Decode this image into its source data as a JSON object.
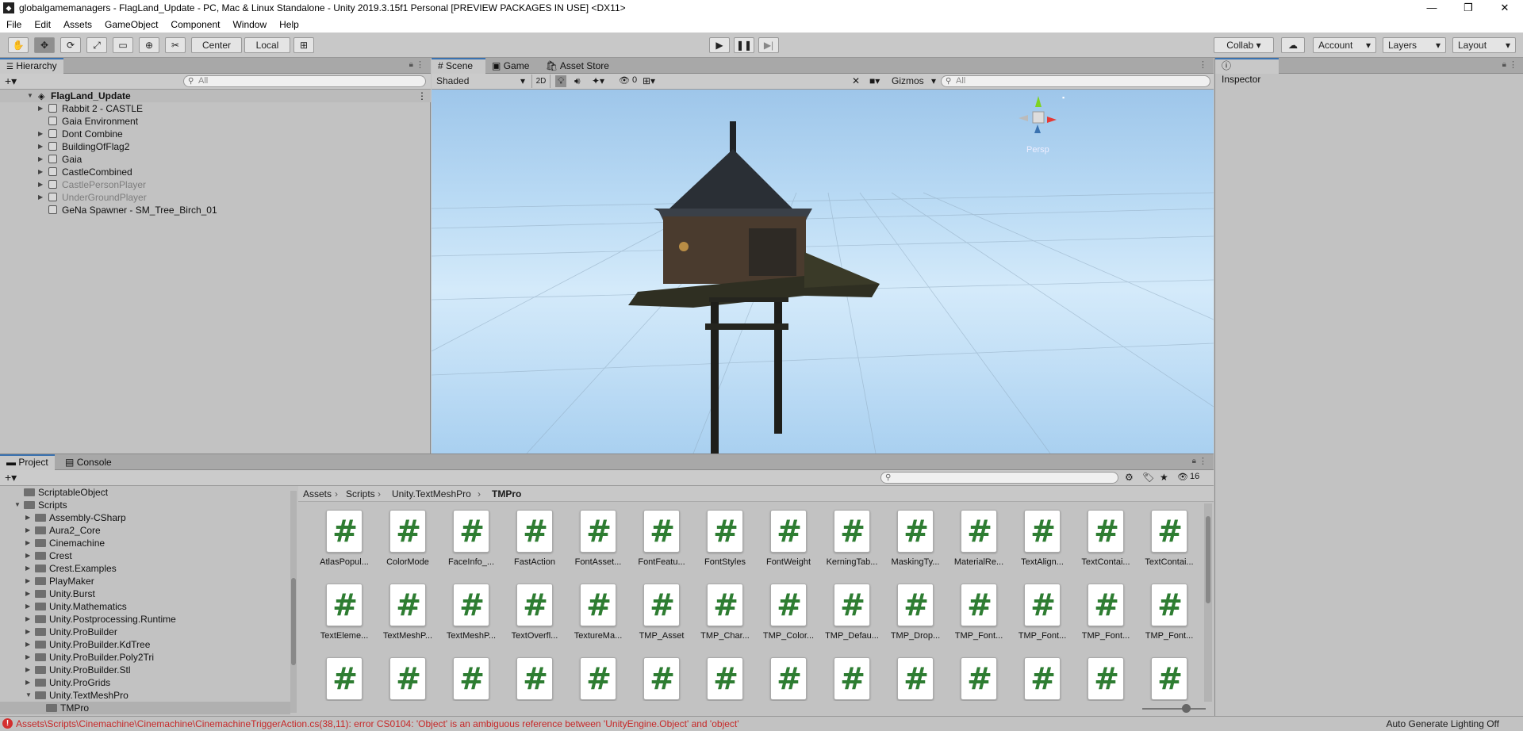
{
  "window": {
    "title": "globalgamemanagers - FlagLand_Update - PC, Mac & Linux Standalone - Unity 2019.3.15f1 Personal [PREVIEW PACKAGES IN USE] <DX11>",
    "controls": {
      "minimize": "—",
      "maximize": "❐",
      "close": "✕"
    }
  },
  "menu": [
    "File",
    "Edit",
    "Assets",
    "GameObject",
    "Component",
    "Window",
    "Help"
  ],
  "toolbar": {
    "tools": [
      "hand-tool-icon",
      "move-tool-icon",
      "rotate-tool-icon",
      "scale-tool-icon",
      "rect-tool-icon",
      "transform-tool-icon",
      "custom-tool-icon"
    ],
    "pivot_label": "Center",
    "space_label": "Local",
    "collab_label": "Collab ▾",
    "account_label": "Account",
    "layers_label": "Layers",
    "layout_label": "Layout"
  },
  "hierarchy": {
    "tab_label": "Hierarchy",
    "search_placeholder": "All",
    "scene_name": "FlagLand_Update",
    "items": [
      {
        "label": "Rabbit 2 - CASTLE",
        "has_children": true,
        "disabled": false
      },
      {
        "label": "Gaia Environment",
        "has_children": false,
        "disabled": false
      },
      {
        "label": "Dont Combine",
        "has_children": true,
        "disabled": false
      },
      {
        "label": "BuildingOfFlag2",
        "has_children": true,
        "disabled": false
      },
      {
        "label": "Gaia",
        "has_children": true,
        "disabled": false
      },
      {
        "label": "CastleCombined",
        "has_children": true,
        "disabled": false
      },
      {
        "label": "CastlePersonPlayer",
        "has_children": true,
        "disabled": true
      },
      {
        "label": "UnderGroundPlayer",
        "has_children": true,
        "disabled": true
      },
      {
        "label": "GeNa Spawner - SM_Tree_Birch_01",
        "has_children": false,
        "disabled": false
      }
    ]
  },
  "scene": {
    "tabs": [
      "Scene",
      "Game",
      "Asset Store"
    ],
    "shading_mode": "Shaded",
    "mode_2d": "2D",
    "hidden_count": "0",
    "gizmos_label": "Gizmos",
    "search_placeholder": "All",
    "persp_label": "Persp"
  },
  "inspector": {
    "tab_label": "Inspector"
  },
  "project": {
    "tabs": [
      "Project",
      "Console"
    ],
    "hidden_count": "16",
    "breadcrumb": [
      "Assets",
      "Scripts",
      "Unity.TextMeshPro",
      "TMPro"
    ],
    "tree": [
      {
        "label": "ScriptableObject",
        "depth": 1,
        "expanded": null
      },
      {
        "label": "Scripts",
        "depth": 1,
        "expanded": true
      },
      {
        "label": "Assembly-CSharp",
        "depth": 2,
        "expanded": false
      },
      {
        "label": "Aura2_Core",
        "depth": 2,
        "expanded": false
      },
      {
        "label": "Cinemachine",
        "depth": 2,
        "expanded": false
      },
      {
        "label": "Crest",
        "depth": 2,
        "expanded": false
      },
      {
        "label": "Crest.Examples",
        "depth": 2,
        "expanded": false
      },
      {
        "label": "PlayMaker",
        "depth": 2,
        "expanded": false
      },
      {
        "label": "Unity.Burst",
        "depth": 2,
        "expanded": false
      },
      {
        "label": "Unity.Mathematics",
        "depth": 2,
        "expanded": false
      },
      {
        "label": "Unity.Postprocessing.Runtime",
        "depth": 2,
        "expanded": false
      },
      {
        "label": "Unity.ProBuilder",
        "depth": 2,
        "expanded": false
      },
      {
        "label": "Unity.ProBuilder.KdTree",
        "depth": 2,
        "expanded": false
      },
      {
        "label": "Unity.ProBuilder.Poly2Tri",
        "depth": 2,
        "expanded": false
      },
      {
        "label": "Unity.ProBuilder.Stl",
        "depth": 2,
        "expanded": false
      },
      {
        "label": "Unity.ProGrids",
        "depth": 2,
        "expanded": false
      },
      {
        "label": "Unity.TextMeshPro",
        "depth": 2,
        "expanded": true
      },
      {
        "label": "TMPro",
        "depth": 3,
        "expanded": null
      }
    ],
    "assets_row1": [
      "AtlasPopul...",
      "ColorMode",
      "FaceInfo_...",
      "FastAction",
      "FontAsset...",
      "FontFeatu...",
      "FontStyles",
      "FontWeight",
      "KerningTab...",
      "MaskingTy...",
      "MaterialRe...",
      "TextAlign...",
      "TextContai...",
      "TextContai..."
    ],
    "assets_row2": [
      "TextEleme...",
      "TextMeshP...",
      "TextMeshP...",
      "TextOverfl...",
      "TextureMa...",
      "TMP_Asset",
      "TMP_Char...",
      "TMP_Color...",
      "TMP_Defau...",
      "TMP_Drop...",
      "TMP_Font...",
      "TMP_Font...",
      "TMP_Font...",
      "TMP_Font..."
    ],
    "assets_row3": [
      "",
      "",
      "",
      "",
      "",
      "",
      "",
      "",
      "",
      "",
      "",
      "",
      "",
      ""
    ],
    "asset_glyph": "#"
  },
  "status": {
    "error_message": "Assets\\Scripts\\Cinemachine\\Cinemachine\\CinemachineTriggerAction.cs(38,11): error CS0104: 'Object' is an ambiguous reference between 'UnityEngine.Object' and 'object'",
    "right_label": "Auto Generate Lighting Off"
  },
  "colors": {
    "accent": "#3a72b0",
    "script_icon": "#2e7d32",
    "error": "#d32f2f"
  }
}
